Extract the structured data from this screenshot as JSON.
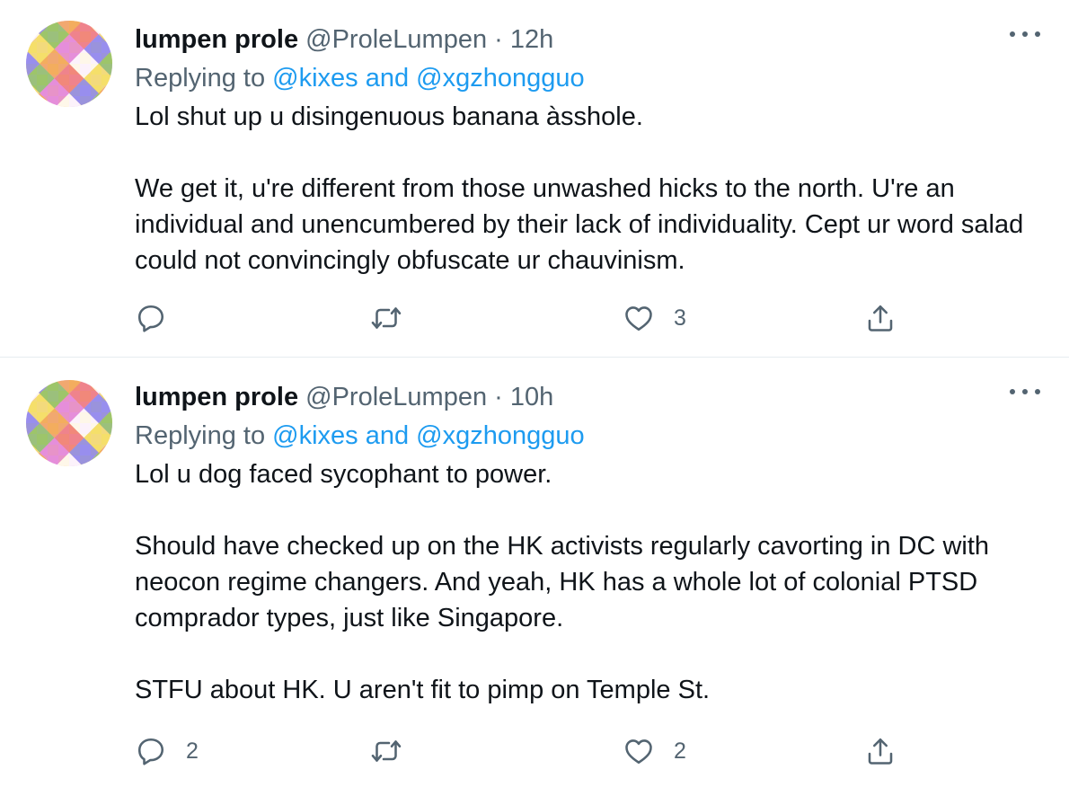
{
  "tweets": [
    {
      "display_name": "lumpen prole",
      "handle": "@ProleLumpen",
      "separator": "·",
      "time": "12h",
      "replying_prefix": "Replying to",
      "replying_mentions": "@kixes and @xgzhongguo",
      "paragraphs": [
        "Lol shut up u disingenuous banana àsshole.",
        "We get it, u're different from those unwashed hicks to the north.  U're an individual and unencumbered by their lack of individuality.  Cept ur word salad could not convincingly obfuscate ur chauvinism."
      ],
      "reply_count": "",
      "retweet_count": "",
      "like_count": "3"
    },
    {
      "display_name": "lumpen prole",
      "handle": "@ProleLumpen",
      "separator": "·",
      "time": "10h",
      "replying_prefix": "Replying to",
      "replying_mentions": "@kixes and @xgzhongguo",
      "paragraphs": [
        "Lol u dog faced sycophant to power.",
        "Should have checked up on the HK activists regularly cavorting in DC with neocon regime changers.  And yeah, HK has a whole lot of colonial PTSD comprador types, just like Singapore.",
        "STFU about HK.  U aren't fit to pimp on Temple St."
      ],
      "reply_count": "2",
      "retweet_count": "",
      "like_count": "2"
    }
  ],
  "icons": {
    "reply": "reply-bubble-icon",
    "retweet": "retweet-arrows-icon",
    "like": "heart-outline-icon",
    "share": "share-upload-icon",
    "more": "more-dots-icon"
  },
  "colors": {
    "text": "#0f1419",
    "secondary": "#536471",
    "link": "#1d9bf0",
    "divider": "#e6ecf0"
  }
}
